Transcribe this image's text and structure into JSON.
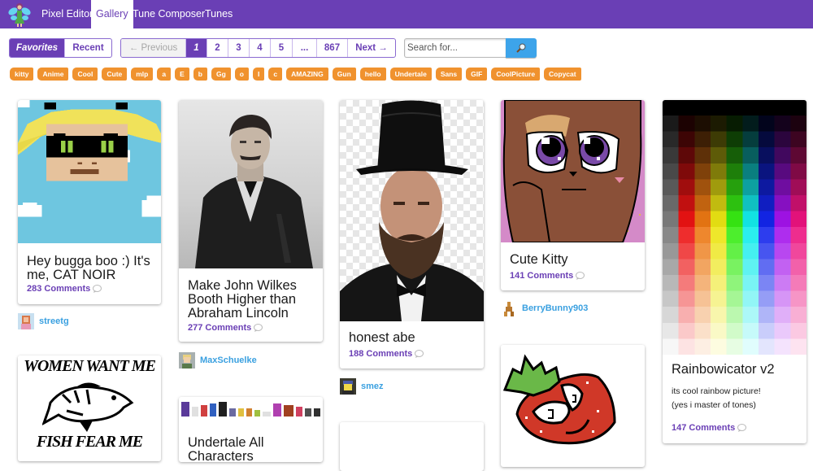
{
  "nav": {
    "logo_icon": "fairy-logo-icon",
    "tabs": [
      {
        "label": "Pixel Editor",
        "active": false
      },
      {
        "label": "Gallery",
        "active": true
      },
      {
        "label": "Tune Composer",
        "active": false
      },
      {
        "label": "Tunes",
        "active": false
      }
    ]
  },
  "toolbar": {
    "sort": [
      {
        "label": "Favorites",
        "active": true
      },
      {
        "label": "Recent",
        "active": false
      }
    ],
    "pagination": {
      "previous": "← Previous",
      "pages": [
        "1",
        "2",
        "3",
        "4",
        "5",
        "...",
        "867"
      ],
      "current": "1",
      "next": "Next →"
    },
    "search": {
      "placeholder": "Search for...",
      "value": "",
      "button_icon": "magnifier-icon"
    }
  },
  "tags": [
    "kitty",
    "Anime",
    "Cool",
    "Cute",
    "mlp",
    "a",
    "E",
    "b",
    "Gg",
    "o",
    "I",
    "c",
    "AMAZING",
    "Gun",
    "hello",
    "Undertale",
    "Sans",
    "GIF",
    "CoolPicture",
    "Copycat"
  ],
  "colors": {
    "brand": "#6a3fb5",
    "tag": "#f0922e",
    "link": "#3aa0e0",
    "search_button": "#3da4ea"
  },
  "gallery": {
    "columns": [
      [
        {
          "title": "Hey bugga boo :) It's me, CAT NOIR",
          "comments": "283 Comments",
          "author": "streetg",
          "image": "pixel-art-cat-noir"
        },
        {
          "title": "",
          "comments": "",
          "author": "",
          "image": "women-want-me-fish-fear-me",
          "image_text_top": "WOMEN WANT ME",
          "image_text_bottom": "FISH FEAR ME"
        }
      ],
      [
        {
          "title": "Make John Wilkes Booth Higher than Abraham Lincoln",
          "comments": "277 Comments",
          "author": "MaxSchuelke",
          "image": "photo-john-wilkes-booth"
        },
        {
          "title": "Undertale All Characters",
          "comments": "",
          "author": "",
          "image": "undertale-character-sprites"
        }
      ],
      [
        {
          "title": "honest abe",
          "comments": "188 Comments",
          "author": "smez",
          "image": "photo-abraham-lincoln-top-hat"
        },
        {
          "title": "",
          "comments": "",
          "author": "",
          "image": "blank"
        }
      ],
      [
        {
          "title": "Cute Kitty",
          "comments": "141 Comments",
          "author": "BerryBunny903",
          "image": "pixel-art-brown-kitty"
        },
        {
          "title": "",
          "comments": "",
          "author": "",
          "image": "pixel-art-strawberry"
        }
      ],
      [
        {
          "title": "Rainbowicator v2",
          "description_lines": [
            "its cool rainbow picture!",
            "(yes i master of tones)"
          ],
          "comments": "147 Comments",
          "author": "",
          "image": "rainbow-palette-grid"
        }
      ]
    ]
  }
}
